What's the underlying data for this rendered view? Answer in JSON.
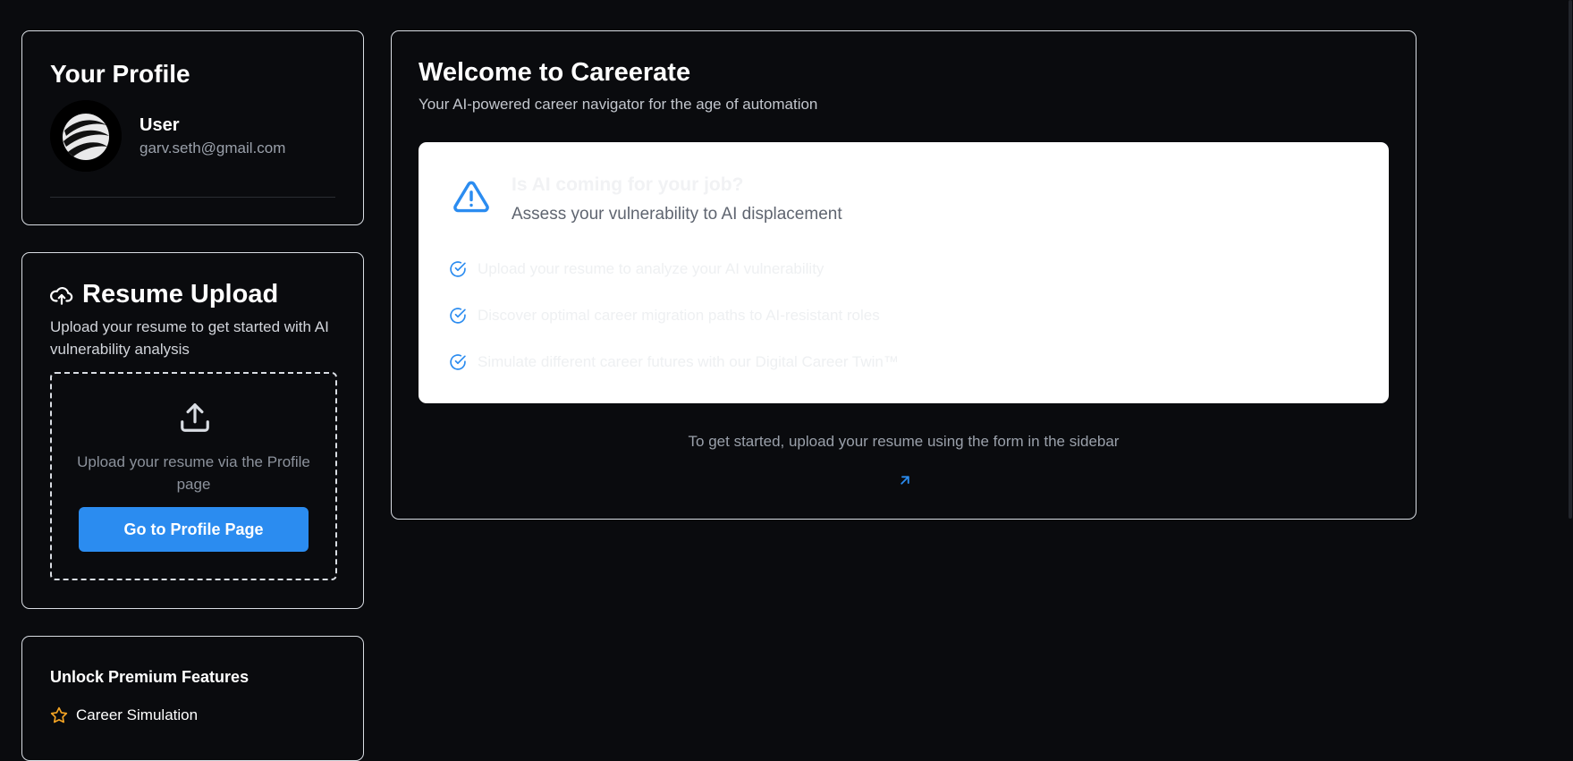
{
  "profile": {
    "title": "Your Profile",
    "user_name": "User",
    "user_email": "garv.seth@gmail.com",
    "avatar_icon": "swirl-logo-icon"
  },
  "resume": {
    "title": "Resume Upload",
    "description": "Upload your resume to get started with AI vulnerability analysis",
    "hint": "Upload your resume via the Profile page",
    "button_label": "Go to Profile Page",
    "icons": [
      "cloud-upload-icon",
      "upload-icon"
    ],
    "accent": "#2b8cf0"
  },
  "premium": {
    "title": "Unlock Premium Features",
    "features": [
      {
        "label": "Career Simulation",
        "icon": "star-icon",
        "color": "#f5a524"
      }
    ]
  },
  "main": {
    "title": "Welcome to Careerate",
    "subtitle": "Your AI-powered career navigator for the age of automation",
    "hero": {
      "title": "Is AI coming for your job?",
      "subtitle": "Assess your vulnerability to AI displacement",
      "icon": "warning-triangle-icon",
      "items": [
        "Upload your resume to analyze your AI vulnerability",
        "Discover optimal career migration paths to AI-resistant roles",
        "Simulate different career futures with our Digital Career Twin™"
      ]
    },
    "footer_text": "To get started, upload your resume using the form in the sidebar",
    "footer_icon": "arrow-up-right-icon"
  },
  "colors": {
    "background": "#0a0b0e",
    "border": "#d9dde3",
    "accent": "#2b8cf0"
  }
}
